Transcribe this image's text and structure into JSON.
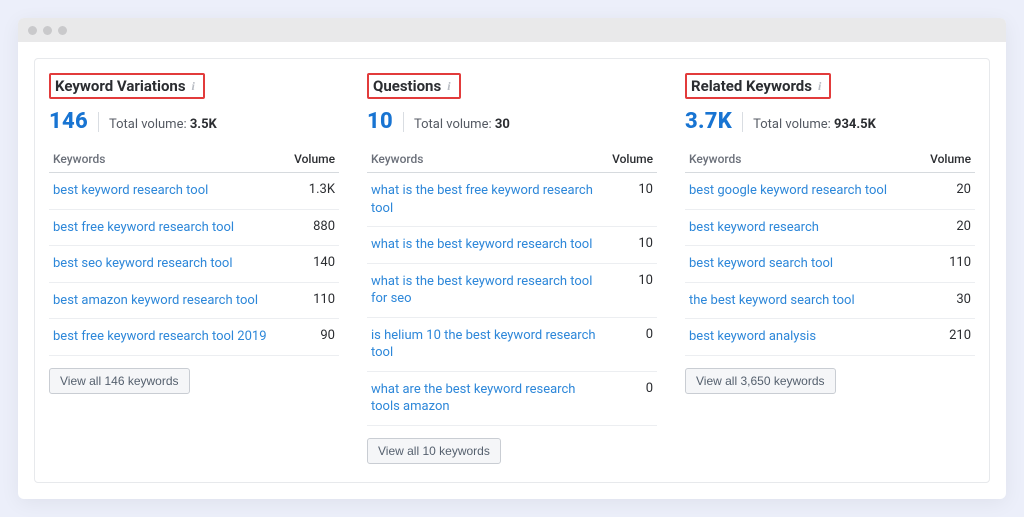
{
  "columns_header": {
    "keywords": "Keywords",
    "volume": "Volume"
  },
  "panels": [
    {
      "title": "Keyword Variations",
      "count": "146",
      "total_volume_label": "Total volume:",
      "total_volume_value": "3.5K",
      "rows": [
        {
          "kw": "best keyword research tool",
          "vol": "1.3K"
        },
        {
          "kw": "best free keyword research tool",
          "vol": "880"
        },
        {
          "kw": "best seo keyword research tool",
          "vol": "140"
        },
        {
          "kw": "best amazon keyword research tool",
          "vol": "110"
        },
        {
          "kw": "best free keyword research tool 2019",
          "vol": "90"
        }
      ],
      "view_all": "View all 146 keywords"
    },
    {
      "title": "Questions",
      "count": "10",
      "total_volume_label": "Total volume:",
      "total_volume_value": "30",
      "rows": [
        {
          "kw": "what is the best free keyword research tool",
          "vol": "10"
        },
        {
          "kw": "what is the best keyword research tool",
          "vol": "10"
        },
        {
          "kw": "what is the best keyword research tool for seo",
          "vol": "10"
        },
        {
          "kw": "is helium 10 the best keyword research tool",
          "vol": "0"
        },
        {
          "kw": "what are the best keyword research tools amazon",
          "vol": "0"
        }
      ],
      "view_all": "View all 10 keywords"
    },
    {
      "title": "Related Keywords",
      "count": "3.7K",
      "total_volume_label": "Total volume:",
      "total_volume_value": "934.5K",
      "rows": [
        {
          "kw": "best google keyword research tool",
          "vol": "20"
        },
        {
          "kw": "best keyword research",
          "vol": "20"
        },
        {
          "kw": "best keyword search tool",
          "vol": "110"
        },
        {
          "kw": "the best keyword search tool",
          "vol": "30"
        },
        {
          "kw": "best keyword analysis",
          "vol": "210"
        }
      ],
      "view_all": "View all 3,650 keywords"
    }
  ]
}
